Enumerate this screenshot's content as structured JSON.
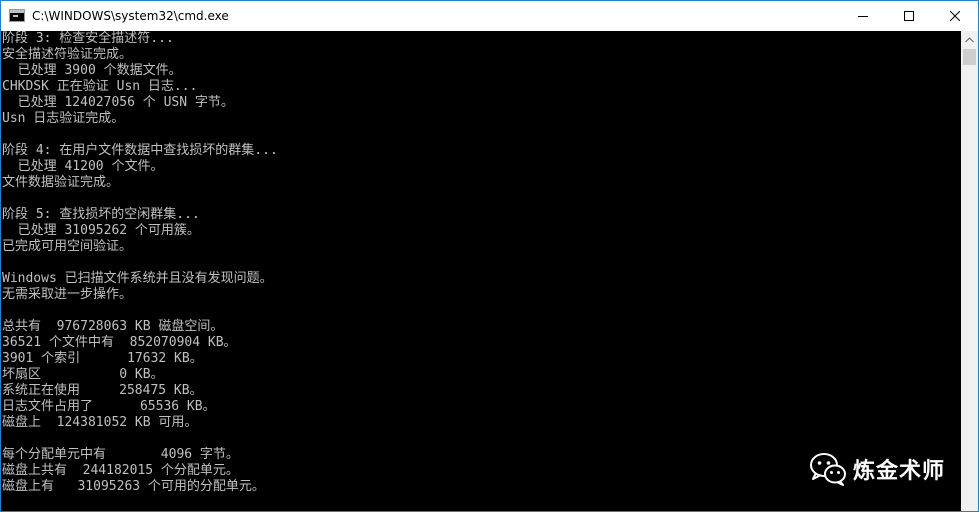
{
  "window": {
    "title": "C:\\WINDOWS\\system32\\cmd.exe",
    "accent": "#1883d7"
  },
  "console": {
    "text_color": "#c0c0c0",
    "background": "#000000",
    "lines": [
      "阶段 3: 检查安全描述符...",
      "安全描述符验证完成。",
      "  已处理 3900 个数据文件。",
      "CHKDSK 正在验证 Usn 日志...",
      "  已处理 124027056 个 USN 字节。",
      "Usn 日志验证完成。",
      "",
      "阶段 4: 在用户文件数据中查找损坏的群集...",
      "  已处理 41200 个文件。",
      "文件数据验证完成。",
      "",
      "阶段 5: 查找损坏的空闲群集...",
      "  已处理 31095262 个可用簇。",
      "已完成可用空间验证。",
      "",
      "Windows 已扫描文件系统并且没有发现问题。",
      "无需采取进一步操作。",
      "",
      "总共有  976728063 KB 磁盘空间。",
      "36521 个文件中有  852070904 KB。",
      "3901 个索引      17632 KB。",
      "坏扇区          0 KB。",
      "系统正在使用     258475 KB。",
      "日志文件占用了      65536 KB。",
      "磁盘上  124381052 KB 可用。",
      "",
      "每个分配单元中有       4096 字节。",
      "磁盘上共有  244182015 个分配单元。",
      "磁盘上有   31095263 个可用的分配单元。"
    ]
  },
  "watermark": {
    "text": "炼金术师",
    "icon": "wechat-icon"
  },
  "icons": {
    "app": "cmd-icon",
    "minimize": "minimize-icon",
    "maximize": "maximize-icon",
    "close": "close-icon",
    "scroll_up": "scroll-up-arrow-icon"
  }
}
